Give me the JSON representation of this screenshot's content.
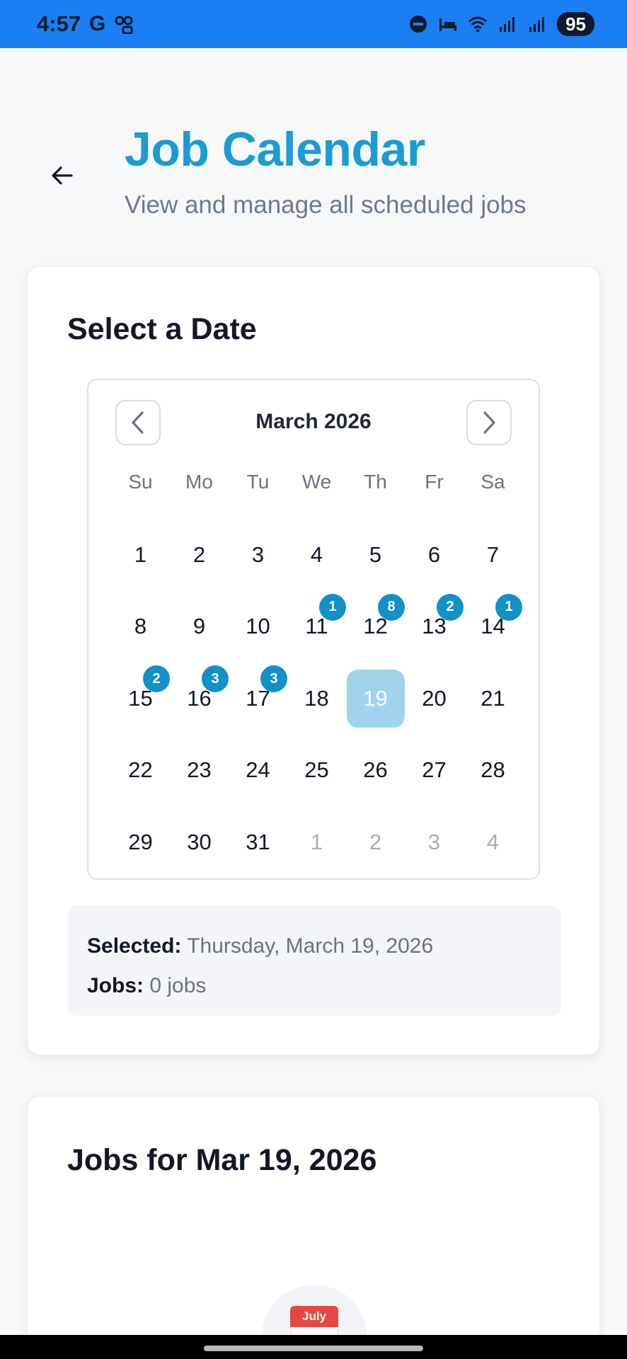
{
  "status_bar": {
    "time": "4:57",
    "battery": "95",
    "left_icons": [
      "google-icon",
      "voicemail-icon"
    ],
    "right_icons": [
      "dnd-icon",
      "bed-icon",
      "wifi-icon",
      "signal-icon",
      "signal-icon"
    ]
  },
  "header": {
    "title": "Job Calendar",
    "subtitle": "View and manage all scheduled jobs"
  },
  "date_card": {
    "title": "Select a Date",
    "calendar": {
      "month_label": "March 2026",
      "weekdays": [
        "Su",
        "Mo",
        "Tu",
        "We",
        "Th",
        "Fr",
        "Sa"
      ],
      "days": [
        {
          "d": "1"
        },
        {
          "d": "2"
        },
        {
          "d": "3"
        },
        {
          "d": "4"
        },
        {
          "d": "5"
        },
        {
          "d": "6"
        },
        {
          "d": "7"
        },
        {
          "d": "8"
        },
        {
          "d": "9"
        },
        {
          "d": "10"
        },
        {
          "d": "11",
          "badge": "1"
        },
        {
          "d": "12",
          "badge": "8"
        },
        {
          "d": "13",
          "badge": "2"
        },
        {
          "d": "14",
          "badge": "1"
        },
        {
          "d": "15",
          "badge": "2"
        },
        {
          "d": "16",
          "badge": "3"
        },
        {
          "d": "17",
          "badge": "3"
        },
        {
          "d": "18"
        },
        {
          "d": "19",
          "selected": true
        },
        {
          "d": "20"
        },
        {
          "d": "21"
        },
        {
          "d": "22"
        },
        {
          "d": "23"
        },
        {
          "d": "24"
        },
        {
          "d": "25"
        },
        {
          "d": "26"
        },
        {
          "d": "27"
        },
        {
          "d": "28"
        },
        {
          "d": "29"
        },
        {
          "d": "30"
        },
        {
          "d": "31"
        },
        {
          "d": "1",
          "muted": true
        },
        {
          "d": "2",
          "muted": true
        },
        {
          "d": "3",
          "muted": true
        },
        {
          "d": "4",
          "muted": true
        }
      ]
    },
    "summary": {
      "selected_label": "Selected:",
      "selected_value": "Thursday, March 19, 2026",
      "jobs_label": "Jobs:",
      "jobs_value": "0 jobs"
    }
  },
  "jobs_card": {
    "title": "Jobs for Mar 19, 2026",
    "empty_icon_text": "July"
  },
  "colors": {
    "status_bar": "#1a7ff5",
    "title": "#1b9bd3",
    "badge": "#1290c8",
    "selected_day": "#9fd4ec"
  }
}
